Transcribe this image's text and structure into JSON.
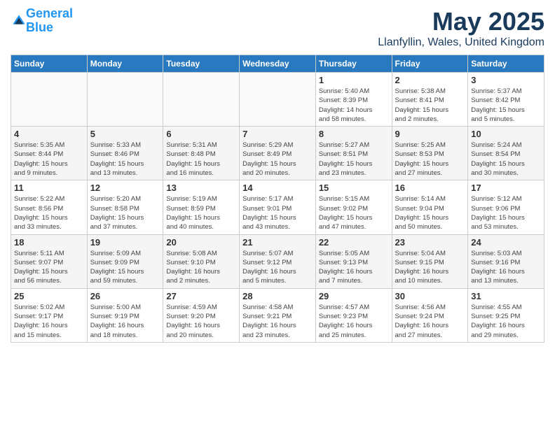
{
  "header": {
    "logo_line1": "General",
    "logo_line2": "Blue",
    "month": "May 2025",
    "location": "Llanfyllin, Wales, United Kingdom"
  },
  "weekdays": [
    "Sunday",
    "Monday",
    "Tuesday",
    "Wednesday",
    "Thursday",
    "Friday",
    "Saturday"
  ],
  "weeks": [
    [
      {
        "day": "",
        "detail": ""
      },
      {
        "day": "",
        "detail": ""
      },
      {
        "day": "",
        "detail": ""
      },
      {
        "day": "",
        "detail": ""
      },
      {
        "day": "1",
        "detail": "Sunrise: 5:40 AM\nSunset: 8:39 PM\nDaylight: 14 hours\nand 58 minutes."
      },
      {
        "day": "2",
        "detail": "Sunrise: 5:38 AM\nSunset: 8:41 PM\nDaylight: 15 hours\nand 2 minutes."
      },
      {
        "day": "3",
        "detail": "Sunrise: 5:37 AM\nSunset: 8:42 PM\nDaylight: 15 hours\nand 5 minutes."
      }
    ],
    [
      {
        "day": "4",
        "detail": "Sunrise: 5:35 AM\nSunset: 8:44 PM\nDaylight: 15 hours\nand 9 minutes."
      },
      {
        "day": "5",
        "detail": "Sunrise: 5:33 AM\nSunset: 8:46 PM\nDaylight: 15 hours\nand 13 minutes."
      },
      {
        "day": "6",
        "detail": "Sunrise: 5:31 AM\nSunset: 8:48 PM\nDaylight: 15 hours\nand 16 minutes."
      },
      {
        "day": "7",
        "detail": "Sunrise: 5:29 AM\nSunset: 8:49 PM\nDaylight: 15 hours\nand 20 minutes."
      },
      {
        "day": "8",
        "detail": "Sunrise: 5:27 AM\nSunset: 8:51 PM\nDaylight: 15 hours\nand 23 minutes."
      },
      {
        "day": "9",
        "detail": "Sunrise: 5:25 AM\nSunset: 8:53 PM\nDaylight: 15 hours\nand 27 minutes."
      },
      {
        "day": "10",
        "detail": "Sunrise: 5:24 AM\nSunset: 8:54 PM\nDaylight: 15 hours\nand 30 minutes."
      }
    ],
    [
      {
        "day": "11",
        "detail": "Sunrise: 5:22 AM\nSunset: 8:56 PM\nDaylight: 15 hours\nand 33 minutes."
      },
      {
        "day": "12",
        "detail": "Sunrise: 5:20 AM\nSunset: 8:58 PM\nDaylight: 15 hours\nand 37 minutes."
      },
      {
        "day": "13",
        "detail": "Sunrise: 5:19 AM\nSunset: 8:59 PM\nDaylight: 15 hours\nand 40 minutes."
      },
      {
        "day": "14",
        "detail": "Sunrise: 5:17 AM\nSunset: 9:01 PM\nDaylight: 15 hours\nand 43 minutes."
      },
      {
        "day": "15",
        "detail": "Sunrise: 5:15 AM\nSunset: 9:02 PM\nDaylight: 15 hours\nand 47 minutes."
      },
      {
        "day": "16",
        "detail": "Sunrise: 5:14 AM\nSunset: 9:04 PM\nDaylight: 15 hours\nand 50 minutes."
      },
      {
        "day": "17",
        "detail": "Sunrise: 5:12 AM\nSunset: 9:06 PM\nDaylight: 15 hours\nand 53 minutes."
      }
    ],
    [
      {
        "day": "18",
        "detail": "Sunrise: 5:11 AM\nSunset: 9:07 PM\nDaylight: 15 hours\nand 56 minutes."
      },
      {
        "day": "19",
        "detail": "Sunrise: 5:09 AM\nSunset: 9:09 PM\nDaylight: 15 hours\nand 59 minutes."
      },
      {
        "day": "20",
        "detail": "Sunrise: 5:08 AM\nSunset: 9:10 PM\nDaylight: 16 hours\nand 2 minutes."
      },
      {
        "day": "21",
        "detail": "Sunrise: 5:07 AM\nSunset: 9:12 PM\nDaylight: 16 hours\nand 5 minutes."
      },
      {
        "day": "22",
        "detail": "Sunrise: 5:05 AM\nSunset: 9:13 PM\nDaylight: 16 hours\nand 7 minutes."
      },
      {
        "day": "23",
        "detail": "Sunrise: 5:04 AM\nSunset: 9:15 PM\nDaylight: 16 hours\nand 10 minutes."
      },
      {
        "day": "24",
        "detail": "Sunrise: 5:03 AM\nSunset: 9:16 PM\nDaylight: 16 hours\nand 13 minutes."
      }
    ],
    [
      {
        "day": "25",
        "detail": "Sunrise: 5:02 AM\nSunset: 9:17 PM\nDaylight: 16 hours\nand 15 minutes."
      },
      {
        "day": "26",
        "detail": "Sunrise: 5:00 AM\nSunset: 9:19 PM\nDaylight: 16 hours\nand 18 minutes."
      },
      {
        "day": "27",
        "detail": "Sunrise: 4:59 AM\nSunset: 9:20 PM\nDaylight: 16 hours\nand 20 minutes."
      },
      {
        "day": "28",
        "detail": "Sunrise: 4:58 AM\nSunset: 9:21 PM\nDaylight: 16 hours\nand 23 minutes."
      },
      {
        "day": "29",
        "detail": "Sunrise: 4:57 AM\nSunset: 9:23 PM\nDaylight: 16 hours\nand 25 minutes."
      },
      {
        "day": "30",
        "detail": "Sunrise: 4:56 AM\nSunset: 9:24 PM\nDaylight: 16 hours\nand 27 minutes."
      },
      {
        "day": "31",
        "detail": "Sunrise: 4:55 AM\nSunset: 9:25 PM\nDaylight: 16 hours\nand 29 minutes."
      }
    ]
  ]
}
